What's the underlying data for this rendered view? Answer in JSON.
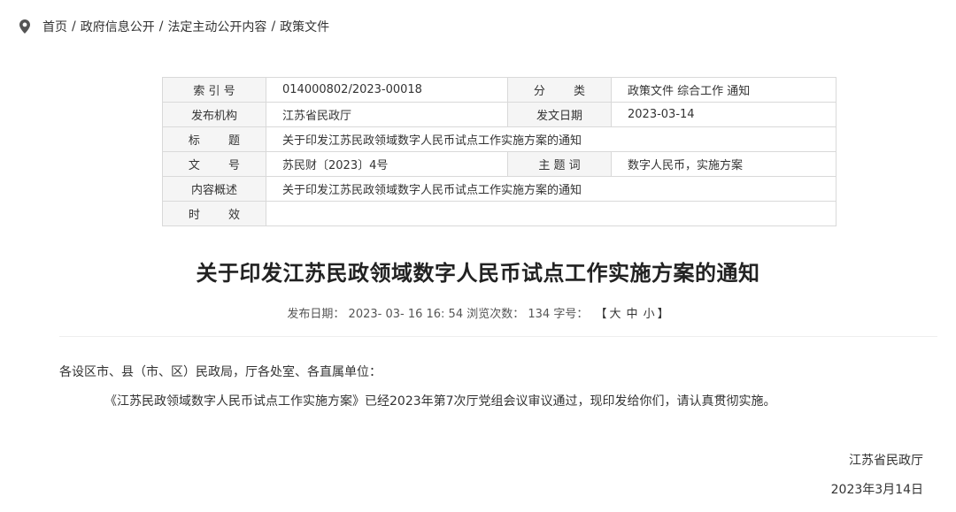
{
  "breadcrumb": {
    "icon": "location-pin-icon",
    "items": [
      "首页",
      "政府信息公开",
      "法定主动公开内容",
      "政策文件"
    ],
    "separator": "/"
  },
  "meta_table": {
    "index_label": "索 引 号",
    "index_value": "014000802/2023-00018",
    "category_label": "分 类",
    "category_value": "政策文件 综合工作 通知",
    "publisher_label": "发布机构",
    "publisher_value": "江苏省民政厅",
    "issue_date_label": "发文日期",
    "issue_date_value": "2023-03-14",
    "title_label": "标 题",
    "title_value": "关于印发江苏民政领域数字人民币试点工作实施方案的通知",
    "doc_no_label": "文 号",
    "doc_no_value": "苏民财〔2023〕4号",
    "keywords_label": "主 题 词",
    "keywords_value": "数字人民币，实施方案",
    "summary_label": "内容概述",
    "summary_value": "关于印发江苏民政领域数字人民币试点工作实施方案的通知",
    "validity_label": "时 效",
    "validity_value": ""
  },
  "article": {
    "title": "关于印发江苏民政领域数字人民币试点工作实施方案的通知",
    "publish_label": "发布日期：",
    "publish_value": "2023- 03- 16 16: 54",
    "views_label": "浏览次数：",
    "views_value": "134",
    "fontsize_label": "字号：",
    "fontsize_open": "【",
    "fontsize_large": "大",
    "fontsize_medium": "中",
    "fontsize_small": "小",
    "fontsize_close": "】",
    "salutation": "各设区市、县（市、区）民政局，厅各处室、各直属单位：",
    "body": "《江苏民政领域数字人民币试点工作实施方案》已经2023年第7次厅党组会议审议通过，现印发给你们，请认真贯彻实施。",
    "sign_org": "江苏省民政厅",
    "sign_date": "2023年3月14日"
  },
  "colors": {
    "text": "#333333",
    "border": "#d9d9d9",
    "label_bg": "#f5f5f5",
    "title": "#222222"
  }
}
